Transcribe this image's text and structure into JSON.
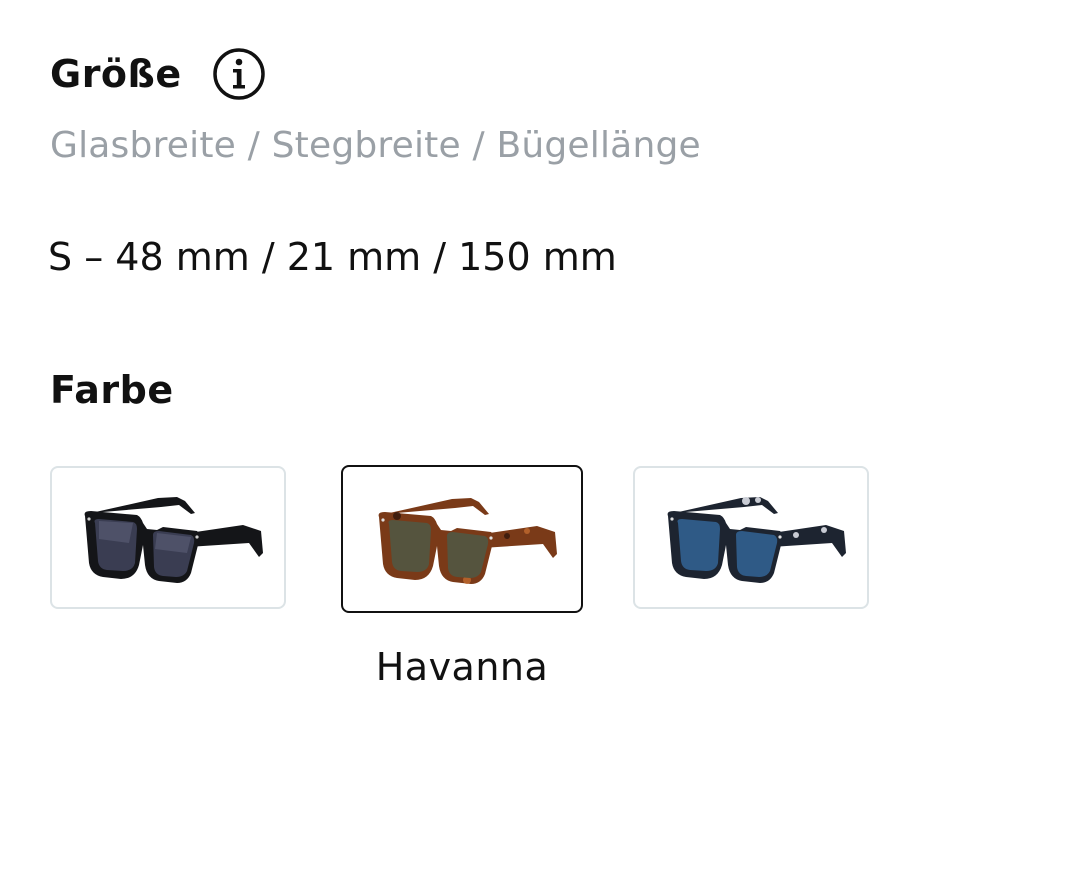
{
  "size_section": {
    "title": "Größe",
    "info_icon": "info-circle-icon",
    "dimensions_label": "Glasbreite / Stegbreite / Bügellänge",
    "selected_size": "S – 48 mm / 21 mm / 150 mm"
  },
  "color_section": {
    "title": "Farbe",
    "options": [
      {
        "frame_color": "#141518",
        "lens_color": "#3a3d52",
        "icon": "black-sunglasses-icon"
      },
      {
        "frame_color": "#7a3a18",
        "lens_color": "#55543e",
        "icon": "havanna-sunglasses-icon",
        "selected": true
      },
      {
        "frame_color": "#1d2430",
        "lens_color": "#2f5a86",
        "icon": "blue-sunglasses-icon"
      }
    ],
    "selected_name": "Havanna"
  }
}
